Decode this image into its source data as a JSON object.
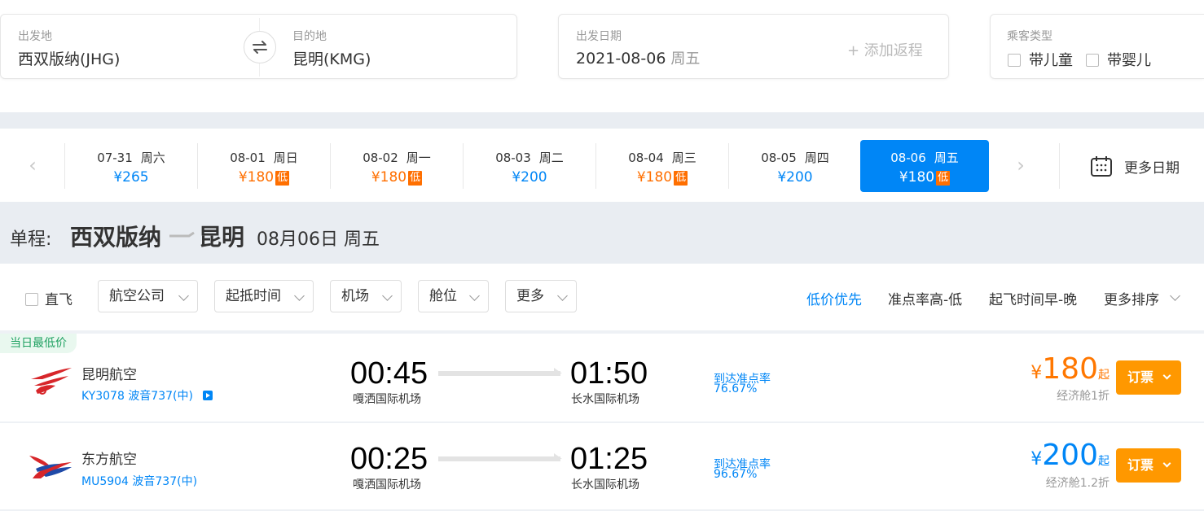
{
  "search": {
    "from_label": "出发地",
    "from_value": "西双版纳(JHG)",
    "to_label": "目的地",
    "to_value": "昆明(KMG)",
    "date_label": "出发日期",
    "date_value": "2021-08-06",
    "date_weekday": "周五",
    "add_return": "+ 添加返程",
    "pax_label": "乘客类型",
    "pax_child": "带儿童",
    "pax_infant": "带婴儿"
  },
  "date_strip": {
    "items": [
      {
        "date": "07-31",
        "weekday": "周六",
        "price": "¥265",
        "low": ""
      },
      {
        "date": "08-01",
        "weekday": "周日",
        "price": "¥180",
        "low": "低"
      },
      {
        "date": "08-02",
        "weekday": "周一",
        "price": "¥180",
        "low": "低"
      },
      {
        "date": "08-03",
        "weekday": "周二",
        "price": "¥200",
        "low": ""
      },
      {
        "date": "08-04",
        "weekday": "周三",
        "price": "¥180",
        "low": "低"
      },
      {
        "date": "08-05",
        "weekday": "周四",
        "price": "¥200",
        "low": ""
      },
      {
        "date": "08-06",
        "weekday": "周五",
        "price": "¥180",
        "low": "低"
      }
    ],
    "more_dates": "更多日期"
  },
  "title": {
    "prefix": "单程:",
    "from_city": "西双版纳",
    "to_city": "昆明",
    "date": "08月06日 周五"
  },
  "filters": {
    "direct": "直飞",
    "airline": "航空公司",
    "time": "起抵时间",
    "airport": "机场",
    "cabin": "舱位",
    "more": "更多"
  },
  "sort": {
    "low_price": "低价优先",
    "ontime": "准点率高-低",
    "departure": "起飞时间早-晚",
    "more": "更多排序"
  },
  "flights": [
    {
      "badge": "当日最低价",
      "airline": "昆明航空",
      "info": "KY3078 波音737(中)",
      "dep_time": "00:45",
      "dep_airport": "嘎洒国际机场",
      "arr_time": "01:50",
      "arr_airport": "长水国际机场",
      "ontime_label": "到达准点率",
      "ontime_value": "76.67%",
      "yen": "¥",
      "price": "180",
      "qi": "起",
      "cabin": "经济舱1折",
      "book": "订票"
    },
    {
      "badge": "",
      "airline": "东方航空",
      "info": "MU5904 波音737(中)",
      "dep_time": "00:25",
      "dep_airport": "嘎洒国际机场",
      "arr_time": "01:25",
      "arr_airport": "长水国际机场",
      "ontime_label": "到达准点率",
      "ontime_value": "96.67%",
      "yen": "¥",
      "price": "200",
      "qi": "起",
      "cabin": "经济舱1.2折",
      "book": "订票"
    }
  ],
  "colors": {
    "accent_blue": "#0086f6",
    "price_orange": "#ff7700",
    "book_orange": "#ff9800",
    "low_tag": "#ff6f00"
  }
}
